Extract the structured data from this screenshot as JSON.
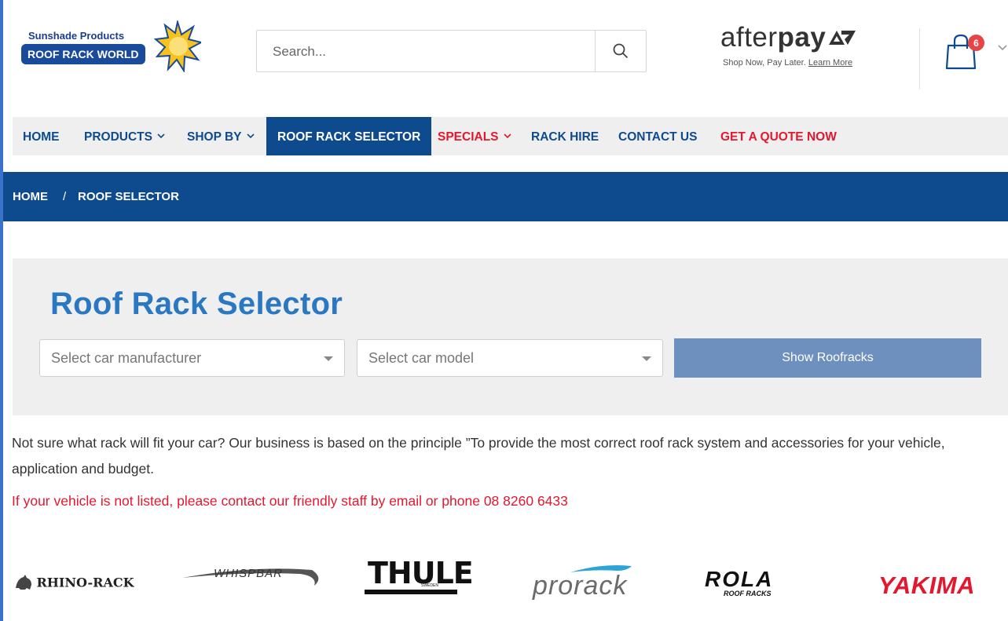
{
  "header": {
    "logo": {
      "line1": "Sunshade Products",
      "line2": "ROOF RACK WORLD"
    },
    "search": {
      "placeholder": "Search..."
    },
    "afterpay": {
      "brand_light": "after",
      "brand_bold": "pay",
      "tagline": "Shop Now, Pay Later.",
      "learn_more": "Learn More"
    },
    "cart": {
      "count": "6"
    }
  },
  "nav": {
    "items": [
      {
        "label": "HOME"
      },
      {
        "label": "PRODUCTS"
      },
      {
        "label": "SHOP BY"
      },
      {
        "label": "ROOF RACK SELECTOR"
      },
      {
        "label": "SPECIALS"
      },
      {
        "label": "RACK HIRE"
      },
      {
        "label": "CONTACT US"
      },
      {
        "label": "GET A QUOTE NOW"
      }
    ]
  },
  "breadcrumb": {
    "home": "HOME",
    "separator": "/",
    "current": "ROOF SELECTOR"
  },
  "selector": {
    "title": "Roof Rack Selector",
    "manufacturer_placeholder": "Select car manufacturer",
    "model_placeholder": "Select car model",
    "button": "Show Roofracks"
  },
  "content": {
    "intro": "Not sure what rack will fit your car? Our business is based on the principle ”To provide the most correct roof rack system and accessories for your vehicle, application and budget.",
    "note": "If your vehicle is not listed, please contact our friendly staff by email or phone 08 8260 6433"
  },
  "brands": {
    "rhino": "RHINO-RACK",
    "whispbar": "WHISPBAR",
    "thule": "THULE",
    "thule_sub": "SWEDEN",
    "prorack": "prorack",
    "rola": "ROLA",
    "rola_sub": "ROOF RACKS",
    "yakima": "YAKIMA"
  },
  "colors": {
    "primary": "#0d4b8e",
    "accent_red": "#e4172e",
    "title_blue": "#2a78c2",
    "button": "#6e90bf"
  }
}
